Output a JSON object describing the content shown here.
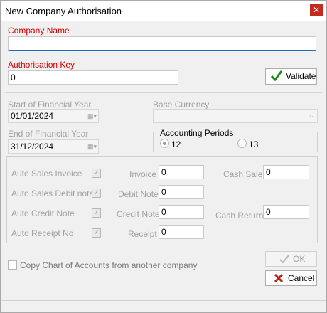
{
  "window": {
    "title": "New Company Authorisation",
    "close_glyph": "✕"
  },
  "company": {
    "label": "Company Name",
    "value": ""
  },
  "authorisation": {
    "label": "Authorisation Key",
    "value": "0",
    "validate_label": "Validate"
  },
  "financial_year": {
    "start_label": "Start of Financial Year",
    "start_value": "01/01/2024",
    "end_label": "End of Financial Year",
    "end_value": "31/12/2024"
  },
  "currency": {
    "label": "Base Currency",
    "value": ""
  },
  "accounting_periods": {
    "label": "Accounting Periods",
    "options": [
      {
        "label": "12",
        "checked": true
      },
      {
        "label": "13",
        "checked": false
      }
    ]
  },
  "auto": {
    "sales_invoice": "Auto Sales Invoice",
    "sales_debit": "Auto Sales Debit note",
    "credit_note": "Auto Credit Note",
    "receipt": "Auto Receipt No"
  },
  "numbers": {
    "invoice_label": "Invoice",
    "invoice_value": "0",
    "debit_label": "Debit Note",
    "debit_value": "0",
    "credit_label": "Credit Note",
    "credit_value": "0",
    "receipt_label": "Receipt",
    "receipt_value": "0",
    "cash_sale_label": "Cash Sale",
    "cash_sale_value": "0",
    "cash_return_label": "Cash Return",
    "cash_return_value": "0"
  },
  "copy_chart": {
    "label": "Copy Chart of Accounts from another company",
    "checked": false
  },
  "buttons": {
    "ok": "OK",
    "cancel": "Cancel"
  },
  "colors": {
    "required_label": "#d40000",
    "disabled_text": "#a0a0a0",
    "validate_check": "#1a8a1a",
    "cancel_x": "#b3261e"
  }
}
